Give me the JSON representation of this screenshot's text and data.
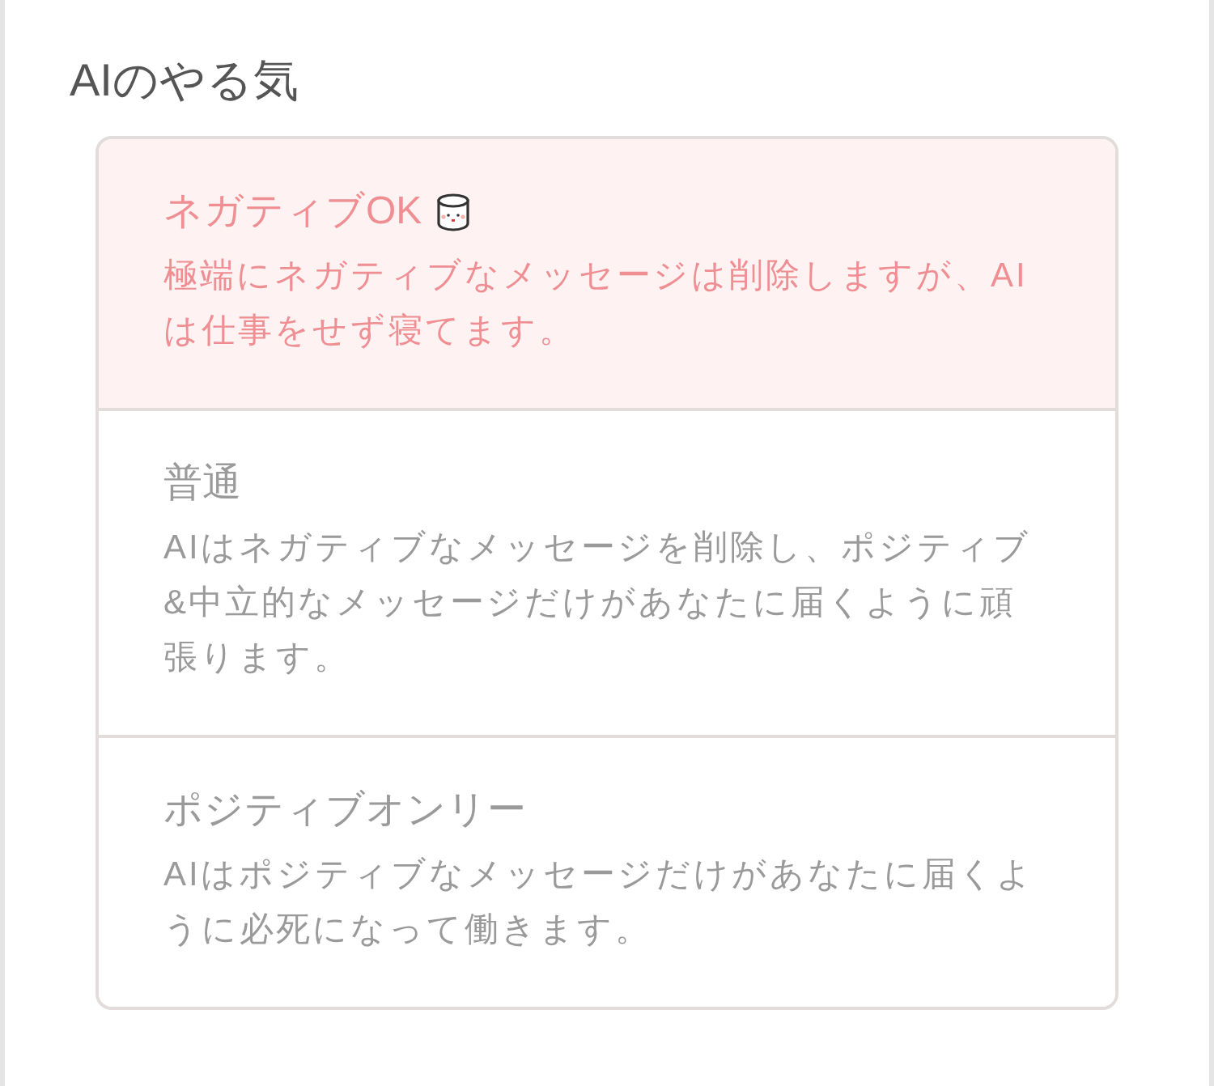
{
  "section_title": "AIのやる気",
  "options": [
    {
      "title": "ネガティブOK",
      "has_icon": true,
      "description": "極端にネガティブなメッセージは削除しますが、AIは仕事をせず寝てます。",
      "selected": true
    },
    {
      "title": "普通",
      "has_icon": false,
      "description": "AIはネガティブなメッセージを削除し、ポジティブ&中立的なメッセージだけがあなたに届くように頑張ります。",
      "selected": false
    },
    {
      "title": "ポジティブオンリー",
      "has_icon": false,
      "description": "AIはポジティブなメッセージだけがあなたに届くように必死になって働きます。",
      "selected": false
    }
  ]
}
